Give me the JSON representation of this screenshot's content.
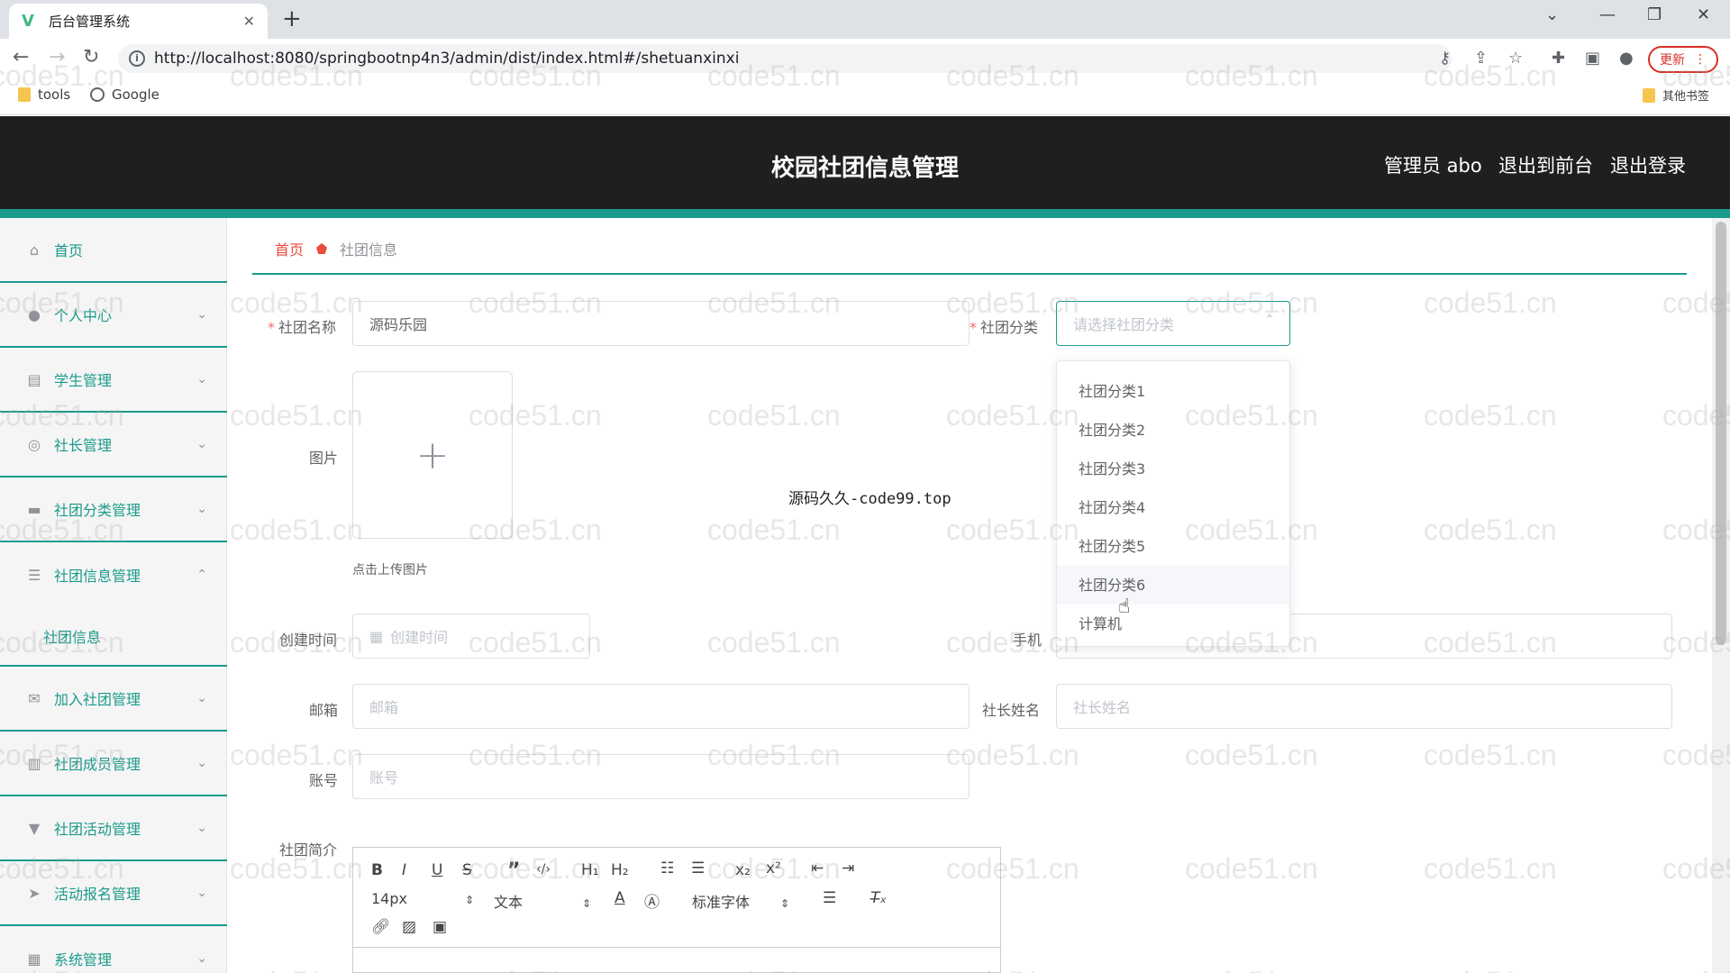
{
  "browser": {
    "tab_title": "后台管理系统",
    "url": "http://localhost:8080/springbootnp4n3/admin/dist/index.html#/shetuanxinxi",
    "update_label": "更新",
    "bookmarks": [
      "tools",
      "Google"
    ],
    "other_bookmarks": "其他书签"
  },
  "header": {
    "title": "校园社团信息管理",
    "user": "管理员 abo",
    "to_front": "退出到前台",
    "logout": "退出登录"
  },
  "sidebar": {
    "items": [
      {
        "label": "首页",
        "icon": "home-icon"
      },
      {
        "label": "个人中心",
        "icon": "user-icon"
      },
      {
        "label": "学生管理",
        "icon": "clipboard-icon"
      },
      {
        "label": "社长管理",
        "icon": "compass-icon"
      },
      {
        "label": "社团分类管理",
        "icon": "briefcase-icon"
      },
      {
        "label": "社团信息管理",
        "icon": "menu-icon"
      },
      {
        "label": "加入社团管理",
        "icon": "mail-icon"
      },
      {
        "label": "社团成员管理",
        "icon": "document-icon"
      },
      {
        "label": "社团活动管理",
        "icon": "podium-icon"
      },
      {
        "label": "活动报名管理",
        "icon": "send-icon"
      },
      {
        "label": "系统管理",
        "icon": "grid-icon"
      }
    ],
    "sub_item": "社团信息"
  },
  "breadcrumb": {
    "home": "首页",
    "current": "社团信息"
  },
  "form": {
    "name_label": "社团名称",
    "name_value": "源码乐园",
    "category_label": "社团分类",
    "category_placeholder": "请选择社团分类",
    "image_label": "图片",
    "upload_tip": "点击上传图片",
    "created_label": "创建时间",
    "created_placeholder": "创建时间",
    "phone_label": "手机",
    "email_label": "邮箱",
    "email_placeholder": "邮箱",
    "leader_label": "社长姓名",
    "leader_placeholder": "社长姓名",
    "account_label": "账号",
    "account_placeholder": "账号",
    "intro_label": "社团简介"
  },
  "dropdown_options": [
    "社团分类1",
    "社团分类2",
    "社团分类3",
    "社团分类4",
    "社团分类5",
    "社团分类6",
    "计算机"
  ],
  "center_text": "源码久久-code99.top",
  "editor": {
    "font_size": "14px",
    "text_type": "文本",
    "font_family": "标准字体"
  },
  "watermark": "code51.cn",
  "colors": {
    "accent": "#1a9a8c",
    "header_bg": "#1f1f1f",
    "danger": "#f56c6c"
  }
}
